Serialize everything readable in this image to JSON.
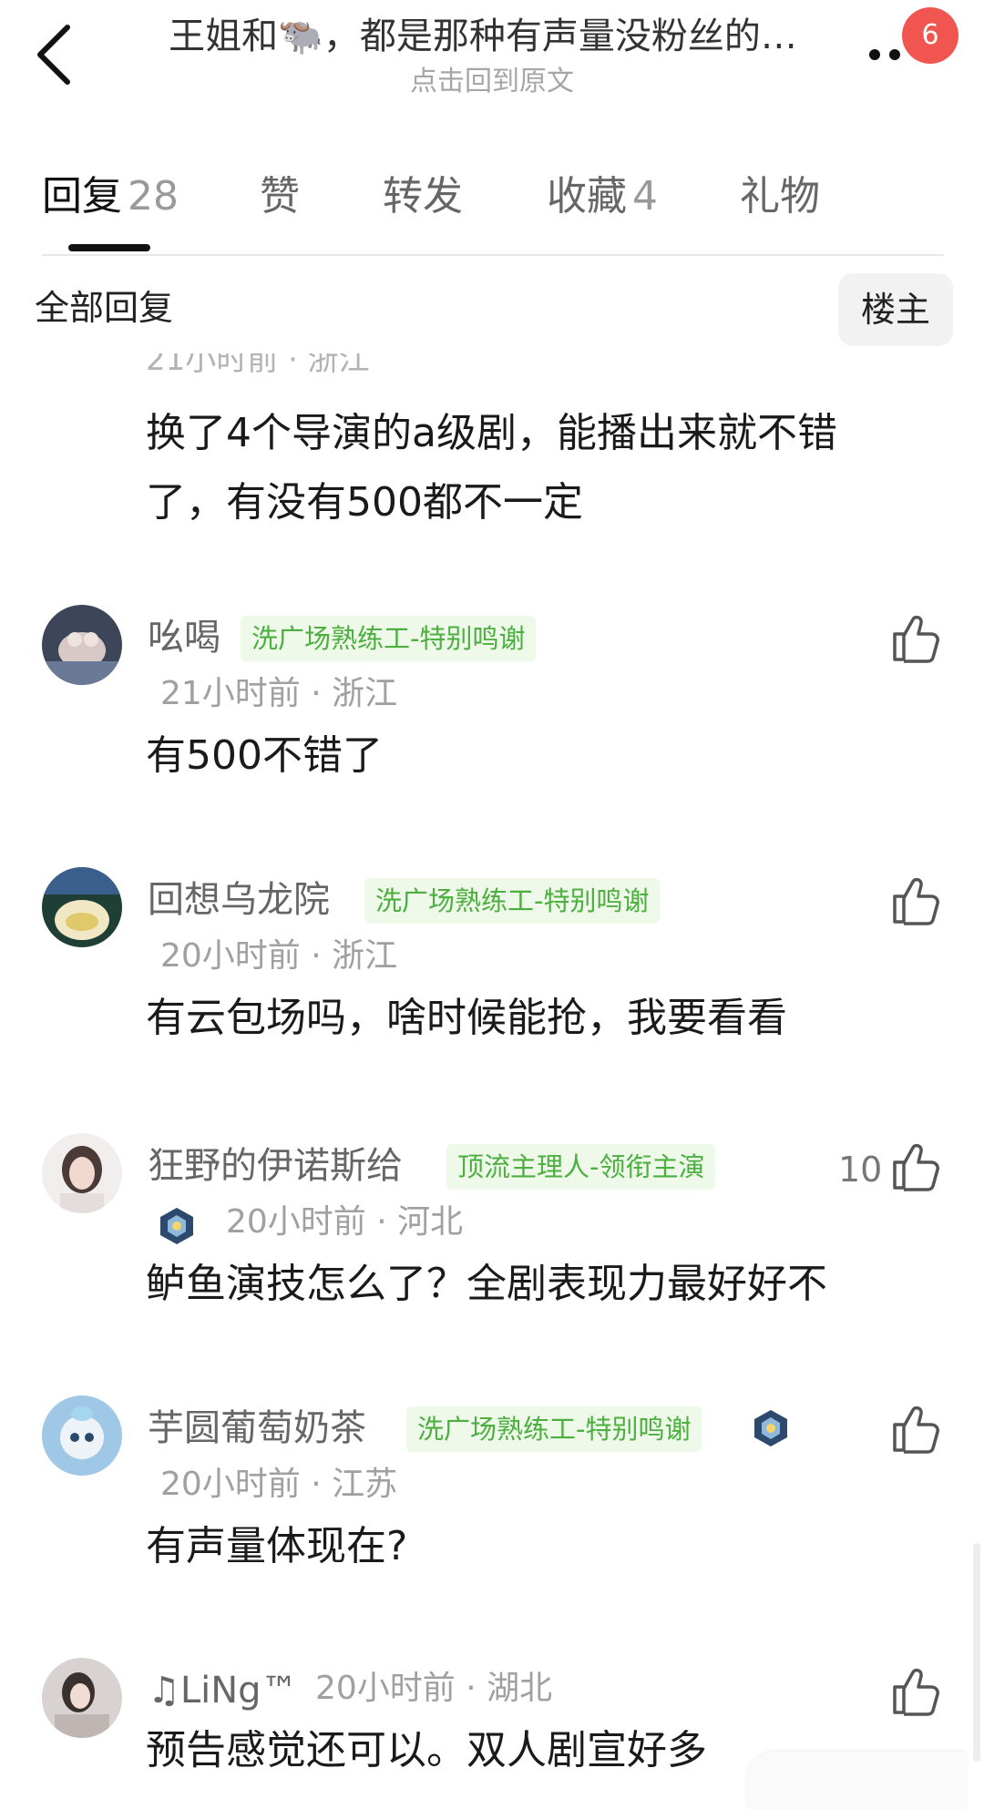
{
  "header": {
    "title": "王姐和🐃，都是那种有声量没粉丝的…",
    "subtitle": "点击回到原文",
    "badge_count": "6"
  },
  "tabs": [
    {
      "label": "回复",
      "count": "28",
      "active": true
    },
    {
      "label": "赞",
      "count": ""
    },
    {
      "label": "转发",
      "count": ""
    },
    {
      "label": "收藏",
      "count": "4"
    },
    {
      "label": "礼物",
      "count": ""
    }
  ],
  "filter": {
    "title": "全部回复",
    "op_only": "楼主"
  },
  "previous_comment": {
    "meta": "21小时前 · 浙江",
    "content_line1": "换了4个导演的a级剧，能播出来就不错",
    "content_line2": "了，有没有500都不一定"
  },
  "comments": [
    {
      "username": "吆喝",
      "tag": "洗广场熟练工-特别鸣谢",
      "meta": "21小时前 · 浙江",
      "content": "有500不错了",
      "likes": ""
    },
    {
      "username": "回想乌龙院",
      "tag": "洗广场熟练工-特别鸣谢",
      "meta": "20小时前 · 浙江",
      "content": "有云包场吗，啥时候能抢，我要看看",
      "likes": ""
    },
    {
      "username": "狂野的伊诺斯给",
      "tag": "顶流主理人-领衔主演",
      "meta": "20小时前 · 河北",
      "content": "鲈鱼演技怎么了？全剧表现力最好好不",
      "likes": "10"
    },
    {
      "username": "芋圆葡萄奶茶",
      "tag": "洗广场熟练工-特别鸣谢",
      "meta": "20小时前 · 江苏",
      "content": "有声量体现在?",
      "likes": ""
    },
    {
      "username": "♫LiNg™",
      "tag": "",
      "meta": "20小时前 · 湖北",
      "content": "预告感觉还可以。双人剧宣好多",
      "likes": ""
    }
  ],
  "colors": {
    "tag_bg": "#eef9ea",
    "tag_text": "#4caf3f",
    "badge": "#f0554f"
  }
}
